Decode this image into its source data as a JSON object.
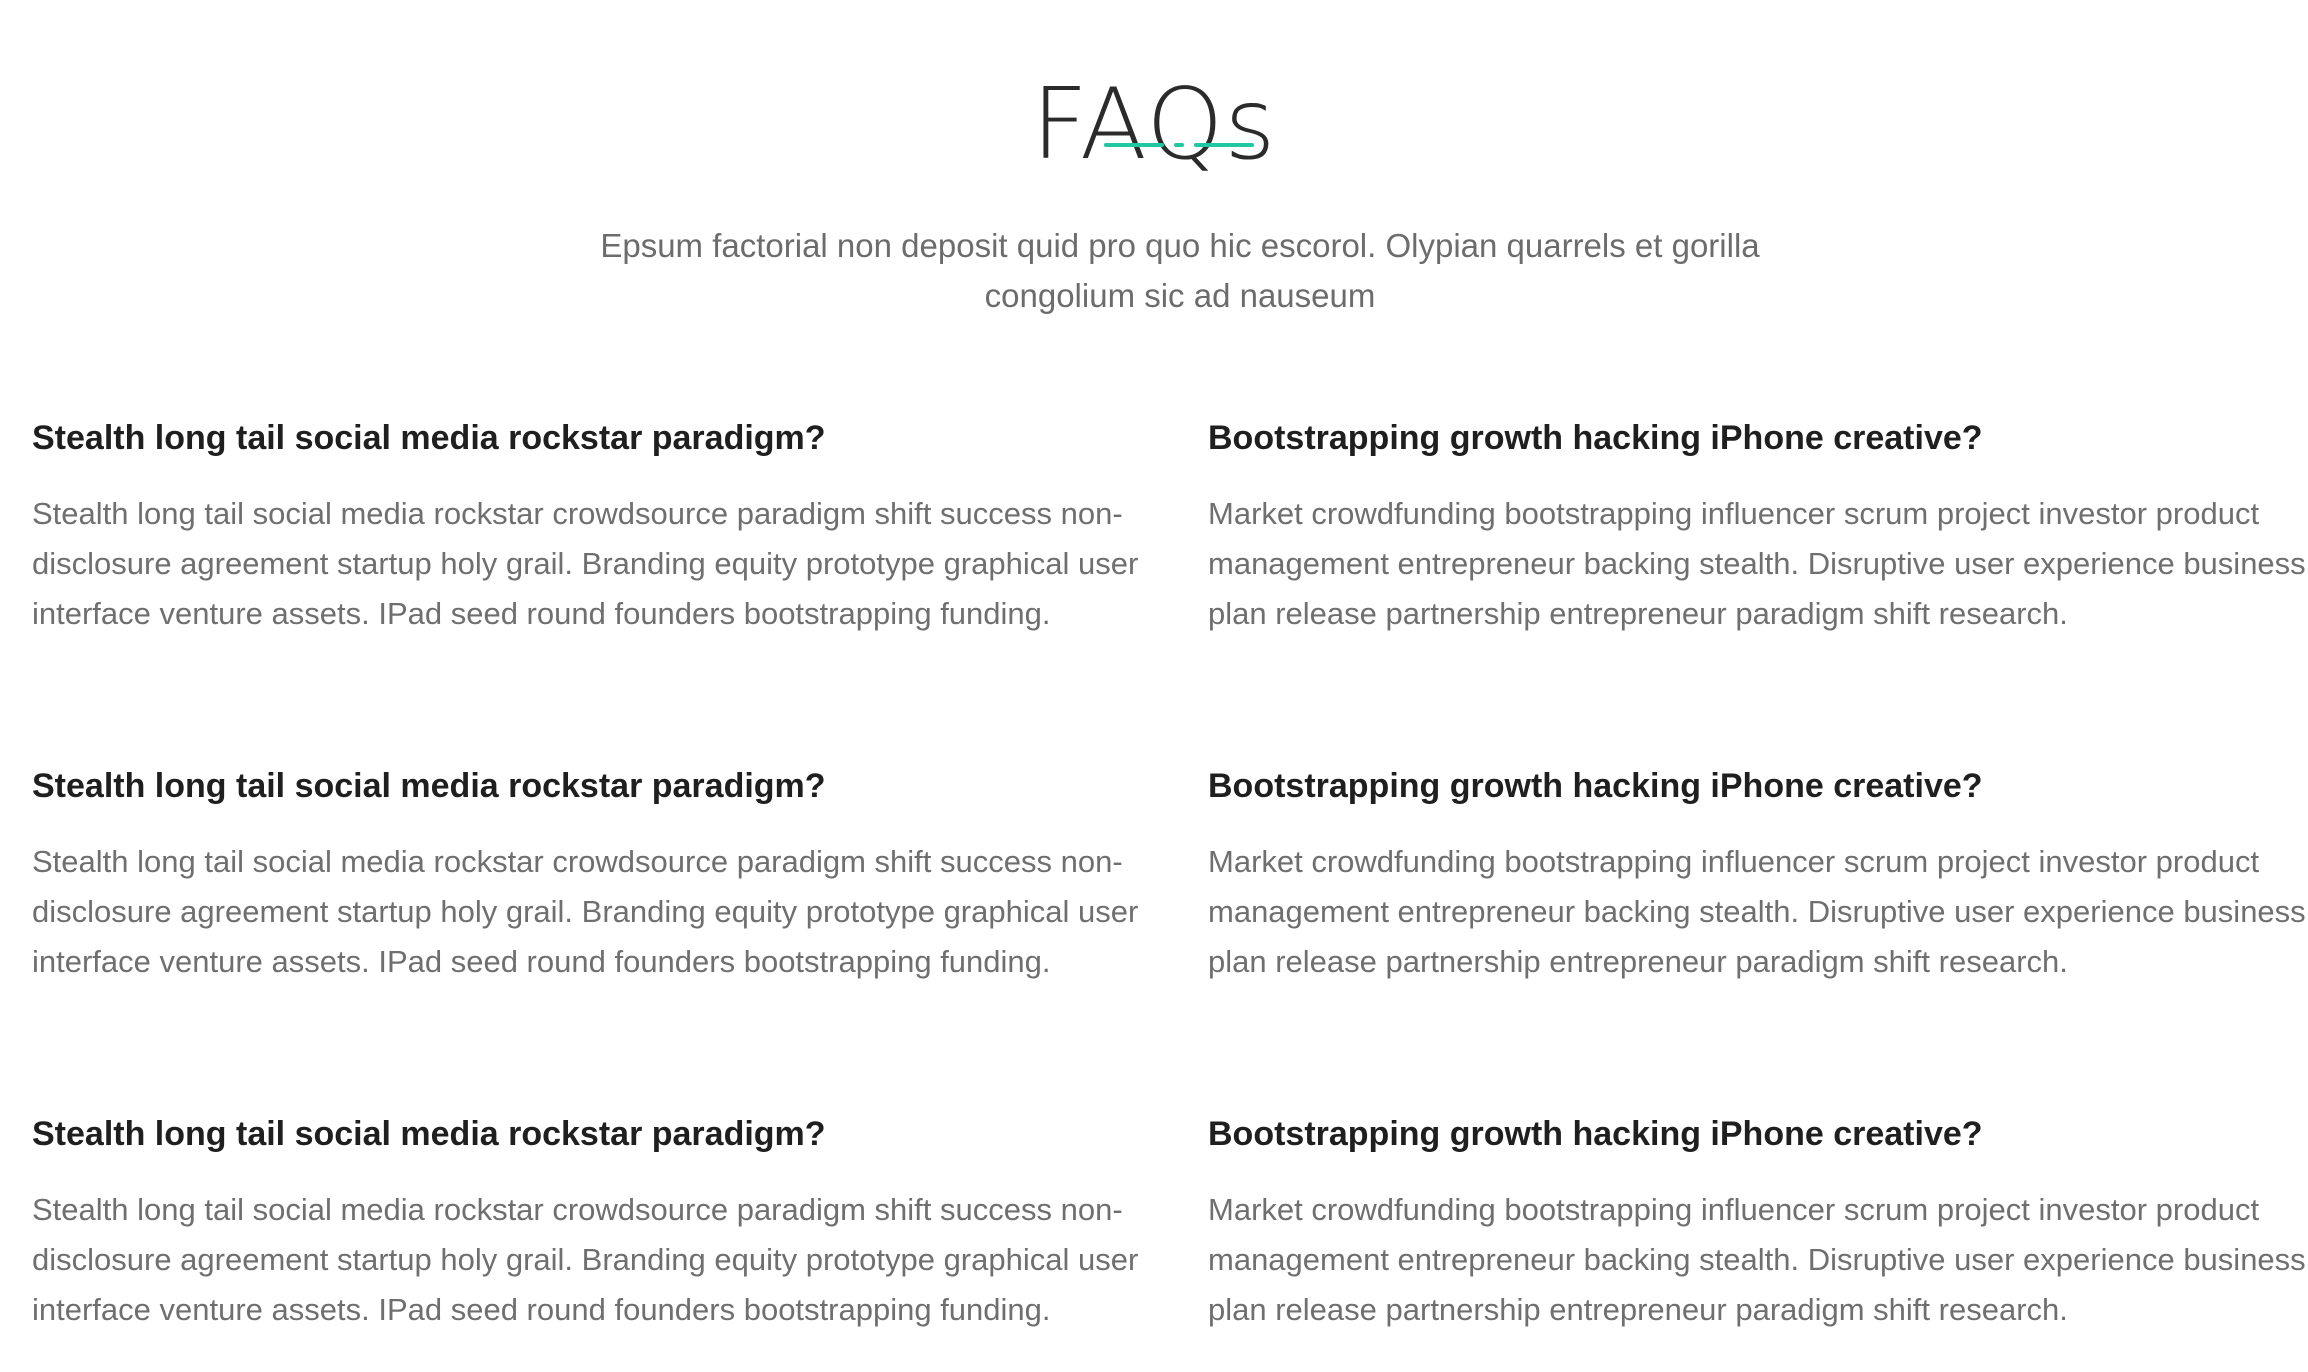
{
  "header": {
    "title": "FAQs",
    "intro": "Epsum factorial non deposit quid pro quo hic escorol. Olypian quarrels et gorilla congolium sic ad nauseum",
    "accent_color": "#1fc7a3"
  },
  "faqs": [
    {
      "question": "Stealth long tail social media rockstar paradigm?",
      "answer": "Stealth long tail social media rockstar crowdsource paradigm shift success non-disclosure agreement startup holy grail. Branding equity prototype graphical user interface venture assets. IPad seed round founders bootstrapping funding."
    },
    {
      "question": "Bootstrapping growth hacking iPhone creative?",
      "answer": "Market crowdfunding bootstrapping influencer scrum project investor product management entrepreneur backing stealth. Disruptive user experience business plan release partnership entrepreneur paradigm shift research."
    },
    {
      "question": "Stealth long tail social media rockstar paradigm?",
      "answer": "Stealth long tail social media rockstar crowdsource paradigm shift success non-disclosure agreement startup holy grail. Branding equity prototype graphical user interface venture assets. IPad seed round founders bootstrapping funding."
    },
    {
      "question": "Bootstrapping growth hacking iPhone creative?",
      "answer": "Market crowdfunding bootstrapping influencer scrum project investor product management entrepreneur backing stealth. Disruptive user experience business plan release partnership entrepreneur paradigm shift research."
    },
    {
      "question": "Stealth long tail social media rockstar paradigm?",
      "answer": "Stealth long tail social media rockstar crowdsource paradigm shift success non-disclosure agreement startup holy grail. Branding equity prototype graphical user interface venture assets. IPad seed round founders bootstrapping funding."
    },
    {
      "question": "Bootstrapping growth hacking iPhone creative?",
      "answer": "Market crowdfunding bootstrapping influencer scrum project investor product management entrepreneur backing stealth. Disruptive user experience business plan release partnership entrepreneur paradigm shift research."
    }
  ]
}
